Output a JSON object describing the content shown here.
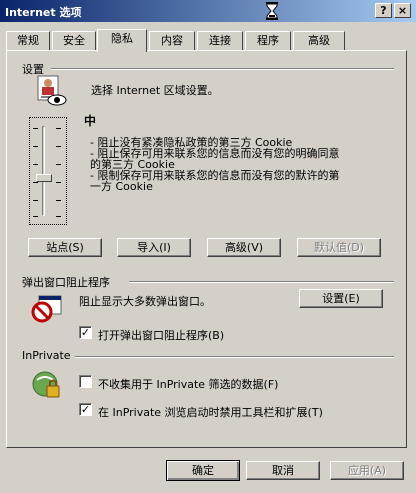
{
  "window": {
    "title": "Internet 选项",
    "help_button": "?",
    "close_button": "×"
  },
  "tabs": [
    {
      "label": "常规",
      "active": false
    },
    {
      "label": "安全",
      "active": false
    },
    {
      "label": "隐私",
      "active": true
    },
    {
      "label": "内容",
      "active": false
    },
    {
      "label": "连接",
      "active": false
    },
    {
      "label": "程序",
      "active": false
    },
    {
      "label": "高级",
      "active": false
    }
  ],
  "settings": {
    "group_title": "设置",
    "instruction": "选择 Internet 区域设置。",
    "level": "中",
    "bullets": [
      "- 阻止没有紧凑隐私政策的第三方 Cookie",
      "- 阻止保存可用来联系您的信息而没有您的明确同意",
      "的第三方 Cookie",
      "- 限制保存可用来联系您的信息而没有您的默许的第",
      "一方 Cookie"
    ],
    "buttons": {
      "sites": "站点(S)",
      "import": "导入(I)",
      "advanced": "高级(V)",
      "default": "默认值(D)"
    }
  },
  "popup": {
    "group_title": "弹出窗口阻止程序",
    "description": "阻止显示大多数弹出窗口。",
    "settings_button": "设置(E)",
    "enable_checkbox": {
      "label": "打开弹出窗口阻止程序(B)",
      "checked": true
    }
  },
  "inprivate": {
    "group_title": "InPrivate",
    "no_collect": {
      "label": "不收集用于 InPrivate 筛选的数据(F)",
      "checked": false
    },
    "disable_toolbars": {
      "label": "在 InPrivate 浏览启动时禁用工具栏和扩展(T)",
      "checked": true
    }
  },
  "footer": {
    "ok": "确定",
    "cancel": "取消",
    "apply": "应用(A)"
  }
}
